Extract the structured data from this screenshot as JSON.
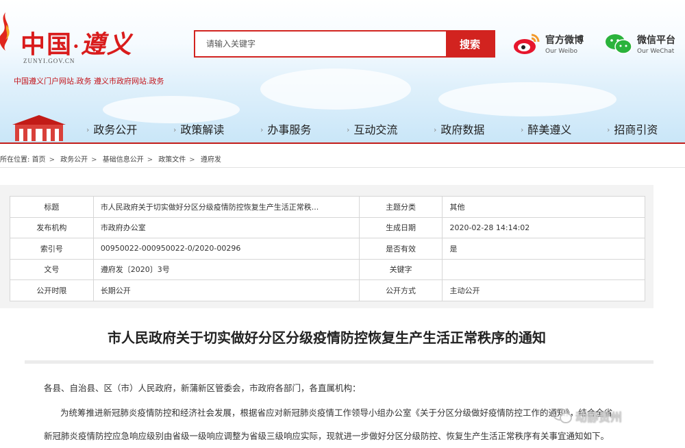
{
  "header": {
    "logo_text": "中国",
    "logo_dot": "·",
    "logo_city": "遵义",
    "logo_domain": "ZUNYI.GOV.CN",
    "logo_subtitle": "中国遵义门户网站.政务  遵义市政府网站.政务",
    "search": {
      "placeholder": "请输入关键字",
      "button_label": "搜索"
    },
    "weibo": {
      "title": "官方微博",
      "subtitle": "Our Weibo",
      "icon": "weibo-icon"
    },
    "wechat": {
      "title": "微信平台",
      "subtitle": "Our WeChat",
      "icon": "wechat-icon"
    },
    "colors": {
      "brand_red": "#d2231f",
      "sky": "#c9e6f8"
    }
  },
  "nav": {
    "items": [
      {
        "label": "政务公开"
      },
      {
        "label": "政策解读"
      },
      {
        "label": "办事服务"
      },
      {
        "label": "互动交流"
      },
      {
        "label": "政府数据"
      },
      {
        "label": "醉美遵义"
      },
      {
        "label": "招商引资"
      }
    ]
  },
  "breadcrumb": {
    "prefix": "所在位置:",
    "items": [
      "首页",
      "政务公开",
      "基础信息公开",
      "政策文件",
      "遵府发"
    ]
  },
  "meta": {
    "rows": [
      {
        "l1": "标题",
        "v1": "市人民政府关于切实做好分区分级疫情防控恢复生产生活正常秩...",
        "l2": "主题分类",
        "v2": "其他"
      },
      {
        "l1": "发布机构",
        "v1": "市政府办公室",
        "l2": "生成日期",
        "v2": "2020-02-28 14:14:02"
      },
      {
        "l1": "索引号",
        "v1": "00950022-000950022-0/2020-00296",
        "l2": "是否有效",
        "v2": "是"
      },
      {
        "l1": "文号",
        "v1": "遵府发〔2020〕3号",
        "l2": "关键字",
        "v2": ""
      },
      {
        "l1": "公开时限",
        "v1": "长期公开",
        "l2": "公开方式",
        "v2": "主动公开"
      }
    ]
  },
  "article": {
    "title": "市人民政府关于切实做好分区分级疫情防控恢复生产生活正常秩序的通知",
    "p1": "各县、自治县、区（市）人民政府，新蒲新区管委会，市政府各部门，各直属机构：",
    "p2": "为统筹推进新冠肺炎疫情防控和经济社会发展，根据省应对新冠肺炎疫情工作领导小组办公室《关于分区分级做好疫情防控工作的通知》，结合全省",
    "p3": "新冠肺炎疫情防控应急响应级别由省级一级响应调整为省级三级响应实际，现就进一步做好分区分级防控、恢复生产生活正常秩序有关事宜通知如下。"
  },
  "watermark": {
    "text": "动静贵州"
  }
}
